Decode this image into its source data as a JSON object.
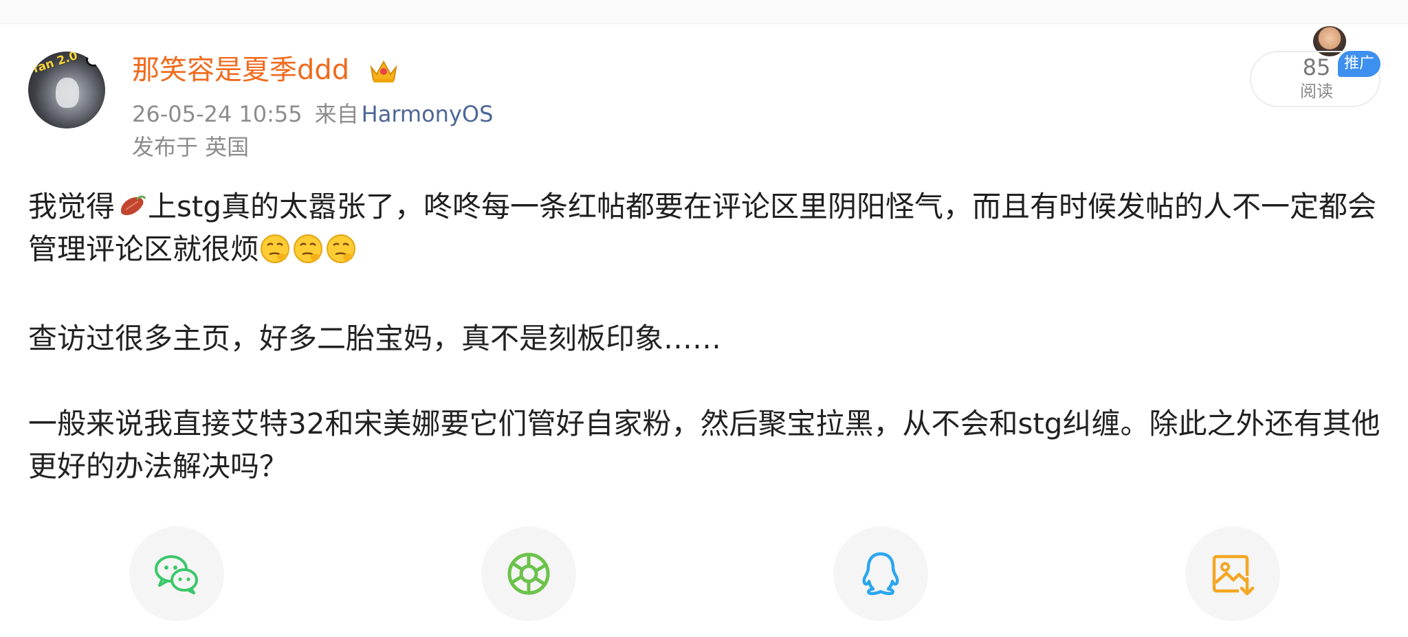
{
  "post": {
    "username": "那笑容是夏季ddd",
    "date_time": "26-05-24 10:55",
    "from_label": "来自",
    "source": "HarmonyOS",
    "location": "发布于 英国",
    "read_count": "85",
    "read_label": "阅读",
    "promo_label": "推广",
    "avatar_badge_text": "fan 2.0",
    "content": {
      "p1_before_icon": "我觉得",
      "p1_after_icon": "上stg真的太嚣张了，咚咚每一条红帖都要在评论区里阴阳怪气，而且有时候发帖的人不一定都会管理评论区就很烦",
      "p2": "查访过很多主页，好多二胎宝妈，真不是刻板印象……",
      "p3": "一般来说我直接艾特32和宋美娜要它们管好自家粉，然后聚宝拉黑，从不会和stg纠缠。除此之外还有其他更好的办法解决吗？"
    }
  },
  "share_buttons": [
    {
      "name": "wechat",
      "icon": "wechat-icon",
      "color": "#3cc76a"
    },
    {
      "name": "moments",
      "icon": "moments-icon",
      "color": "#6cc24a"
    },
    {
      "name": "qq",
      "icon": "qq-icon",
      "color": "#2aa6f0"
    },
    {
      "name": "save-image",
      "icon": "save-image-icon",
      "color": "#f5a623"
    }
  ],
  "colors": {
    "username": "#f06a1c",
    "meta": "#8c8c8c",
    "source_link": "#4d6796",
    "promo": "#3d8ff0"
  }
}
